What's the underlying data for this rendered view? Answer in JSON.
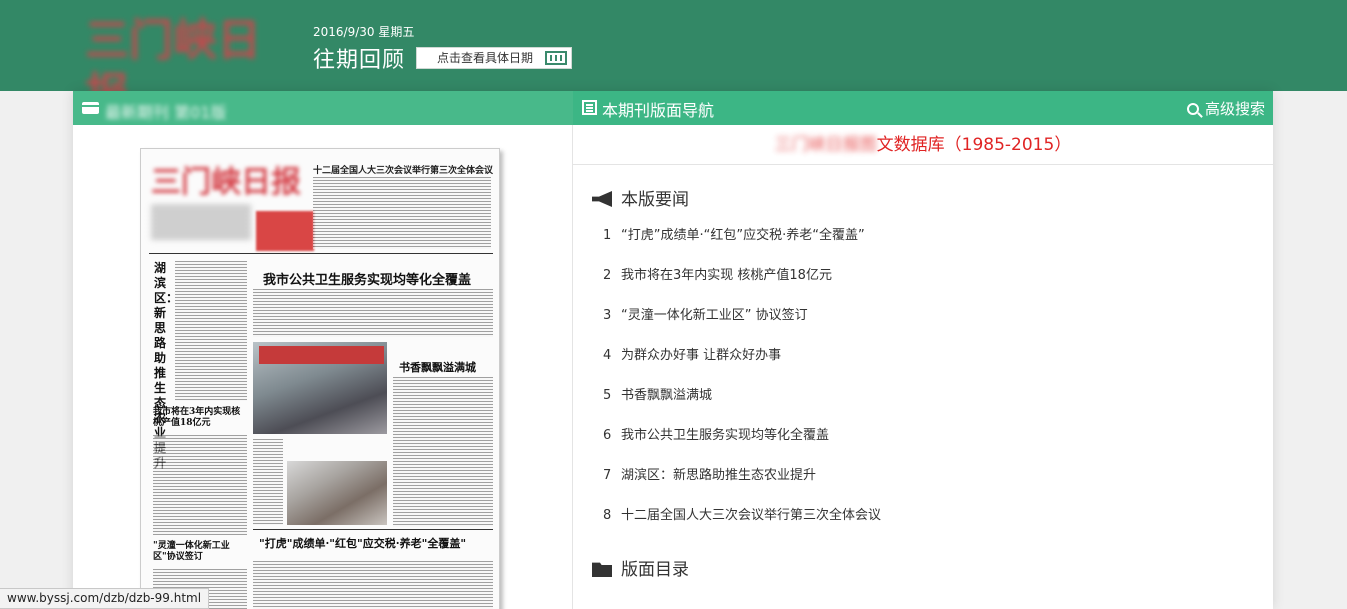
{
  "header": {
    "logo_text": "三门峡日报",
    "date": "2016/9/30 星期五",
    "title": "往期回顾",
    "date_picker_label": "点击查看具体日期"
  },
  "left_panel": {
    "title": "最新期刊 第01版",
    "paper": {
      "masthead": "三门峡日报",
      "headline_top": "十二届全国人大三次会议举行第三次全体会议",
      "headline_main": "我市公共卫生服务实现均等化全覆盖",
      "vertical_headline": "湖滨区：新思路助推生态农业提升",
      "side_headline": "我市将在3年内实现核桃产值18亿元",
      "side_headline2": "\"灵潼一体化新工业区\"协议签订",
      "right_headline": "书香飘飘溢满城",
      "bottom_headline": "\"打虎\"成绩单·\"红包\"应交税·养老\"全覆盖\""
    }
  },
  "right_panel": {
    "nav_title": "本期刊版面导航",
    "search_label": "高级搜索",
    "db_title_blurred": "三门峡日报图",
    "db_title": "文数据库（1985-2015）",
    "section_news": "本版要闻",
    "section_catalog": "版面目录",
    "news_items": [
      {
        "num": "1",
        "title": "“打虎”成绩单·“红包”应交税·养老“全覆盖”"
      },
      {
        "num": "2",
        "title": "我市将在3年内实现 核桃产值18亿元"
      },
      {
        "num": "3",
        "title": "“灵潼一体化新工业区” 协议签订"
      },
      {
        "num": "4",
        "title": "为群众办好事 让群众好办事"
      },
      {
        "num": "5",
        "title": "书香飘飘溢满城"
      },
      {
        "num": "6",
        "title": "我市公共卫生服务实现均等化全覆盖"
      },
      {
        "num": "7",
        "title": "湖滨区：新思路助推生态农业提升"
      },
      {
        "num": "8",
        "title": "十二届全国人大三次会议举行第三次全体会议"
      }
    ]
  },
  "status_url": "www.byssj.com/dzb/dzb-99.html"
}
